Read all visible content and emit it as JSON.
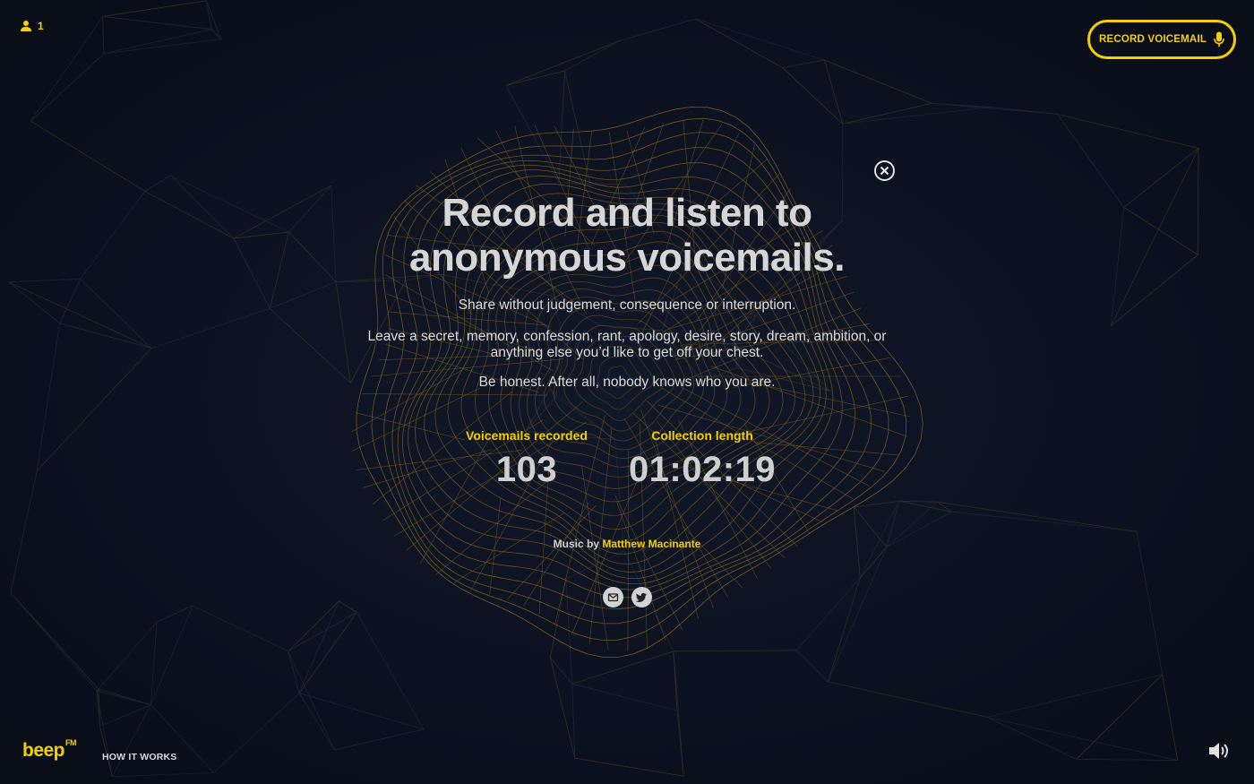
{
  "header": {
    "listener_count": "1",
    "record_button_label": "RECORD VOICEMAIL"
  },
  "intro": {
    "headline_line1": "Record and listen to",
    "headline_line2": "anonymous voicemails.",
    "paragraph1": "Share without judgement, consequence or interruption.",
    "paragraph2": "Leave a secret, memory, confession, rant, apology, desire, story, dream, ambition, or anything else you’d like to get off your chest.",
    "paragraph3": "Be honest. After all, nobody knows who you are."
  },
  "stats": {
    "recorded_label": "Voicemails recorded",
    "recorded_value": "103",
    "length_label": "Collection length",
    "length_value": "01:02:19"
  },
  "credit": {
    "prefix": "Music by",
    "artist": "Matthew Macinante"
  },
  "footer": {
    "logo": "beep",
    "logo_sup": "FM",
    "how_it_works": "HOW IT WORKS"
  },
  "icons": {
    "listener": "user-icon",
    "record": "microphone-icon",
    "close": "close-icon",
    "email": "mail-icon",
    "twitter": "twitter-icon",
    "volume": "volume-icon"
  },
  "colors": {
    "accent": "#f5d000",
    "background": "#0c1120",
    "mesh": "#8a6a1e"
  }
}
